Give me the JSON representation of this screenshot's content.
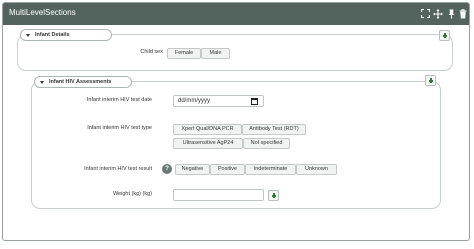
{
  "panel": {
    "title": "MultiLevelSections"
  },
  "header_icons": [
    "expand-icon",
    "move-icon",
    "pin-icon",
    "trash-icon"
  ],
  "infant_details": {
    "legend": "Infant Details",
    "child_sex": {
      "label": "Child sex",
      "options": [
        "Female",
        "Male"
      ]
    }
  },
  "hiv_assessments": {
    "legend": "Infant HIV Assessments",
    "test_date": {
      "label": "Infant interim HIV test date",
      "placeholder": "dd/mm/yyyy"
    },
    "test_type": {
      "label": "Infant interim HIV test type",
      "options": [
        "Xpert Qual/DNA PCR",
        "Antibody Test (RDT)",
        "Ultrasensitive AgP24",
        "Not specified"
      ]
    },
    "test_result": {
      "label": "Infant interim HIV test result",
      "options": [
        "Negative",
        "Positive",
        "Indeterminate",
        "Unknown"
      ]
    },
    "weight": {
      "label": "Weight (kg) (kg)",
      "value": ""
    }
  },
  "colors": {
    "header_bg": "#53645f",
    "add_icon": "#2e7d32"
  }
}
